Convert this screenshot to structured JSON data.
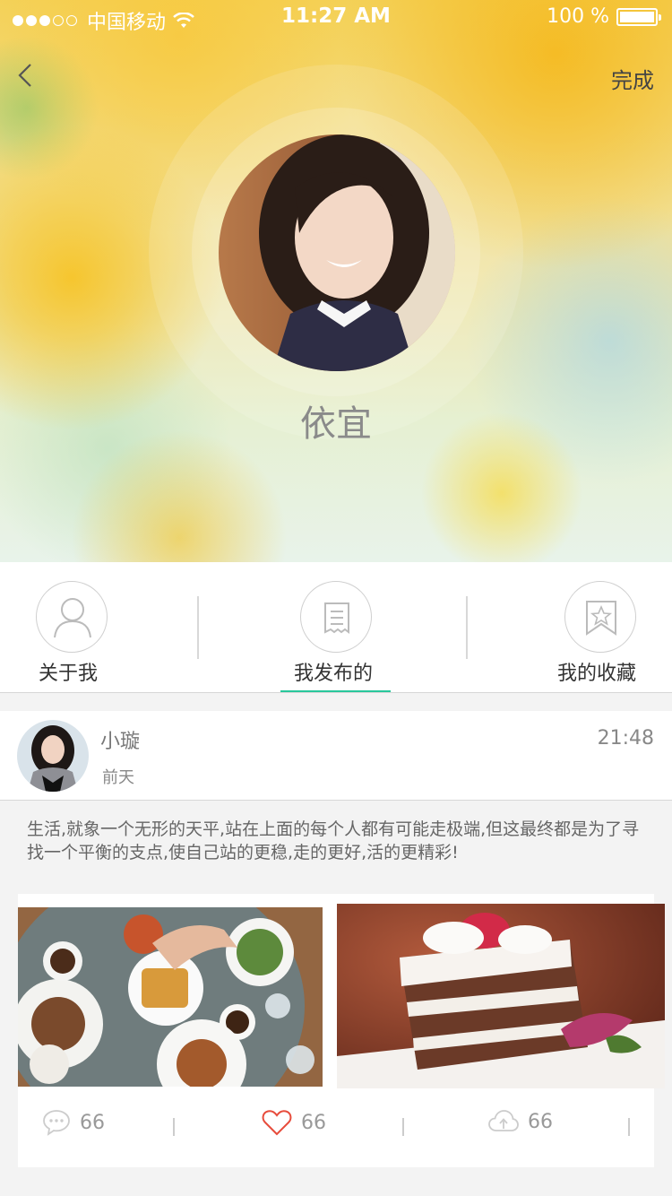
{
  "status_bar": {
    "carrier": "中国移动",
    "time": "11:27 AM",
    "battery": "100 %"
  },
  "nav": {
    "done_label": "完成"
  },
  "profile": {
    "name": "依宜"
  },
  "tabs": [
    {
      "label": "关于我",
      "icon": "user-icon"
    },
    {
      "label": "我发布的",
      "icon": "document-icon",
      "active": true
    },
    {
      "label": "我的收藏",
      "icon": "bookmark-star-icon"
    }
  ],
  "post": {
    "author": "小璇",
    "day": "前天",
    "time": "21:48",
    "text": "生活,就象一个无形的天平,站在上面的每个人都有可能走极端,但这最终都是为了寻找一个平衡的支点,使自己站的更稳,走的更好,活的更精彩!",
    "comments": "66",
    "likes": "66",
    "shares": "66"
  },
  "colors": {
    "accent": "#28c79b",
    "like": "#e74c3c"
  }
}
